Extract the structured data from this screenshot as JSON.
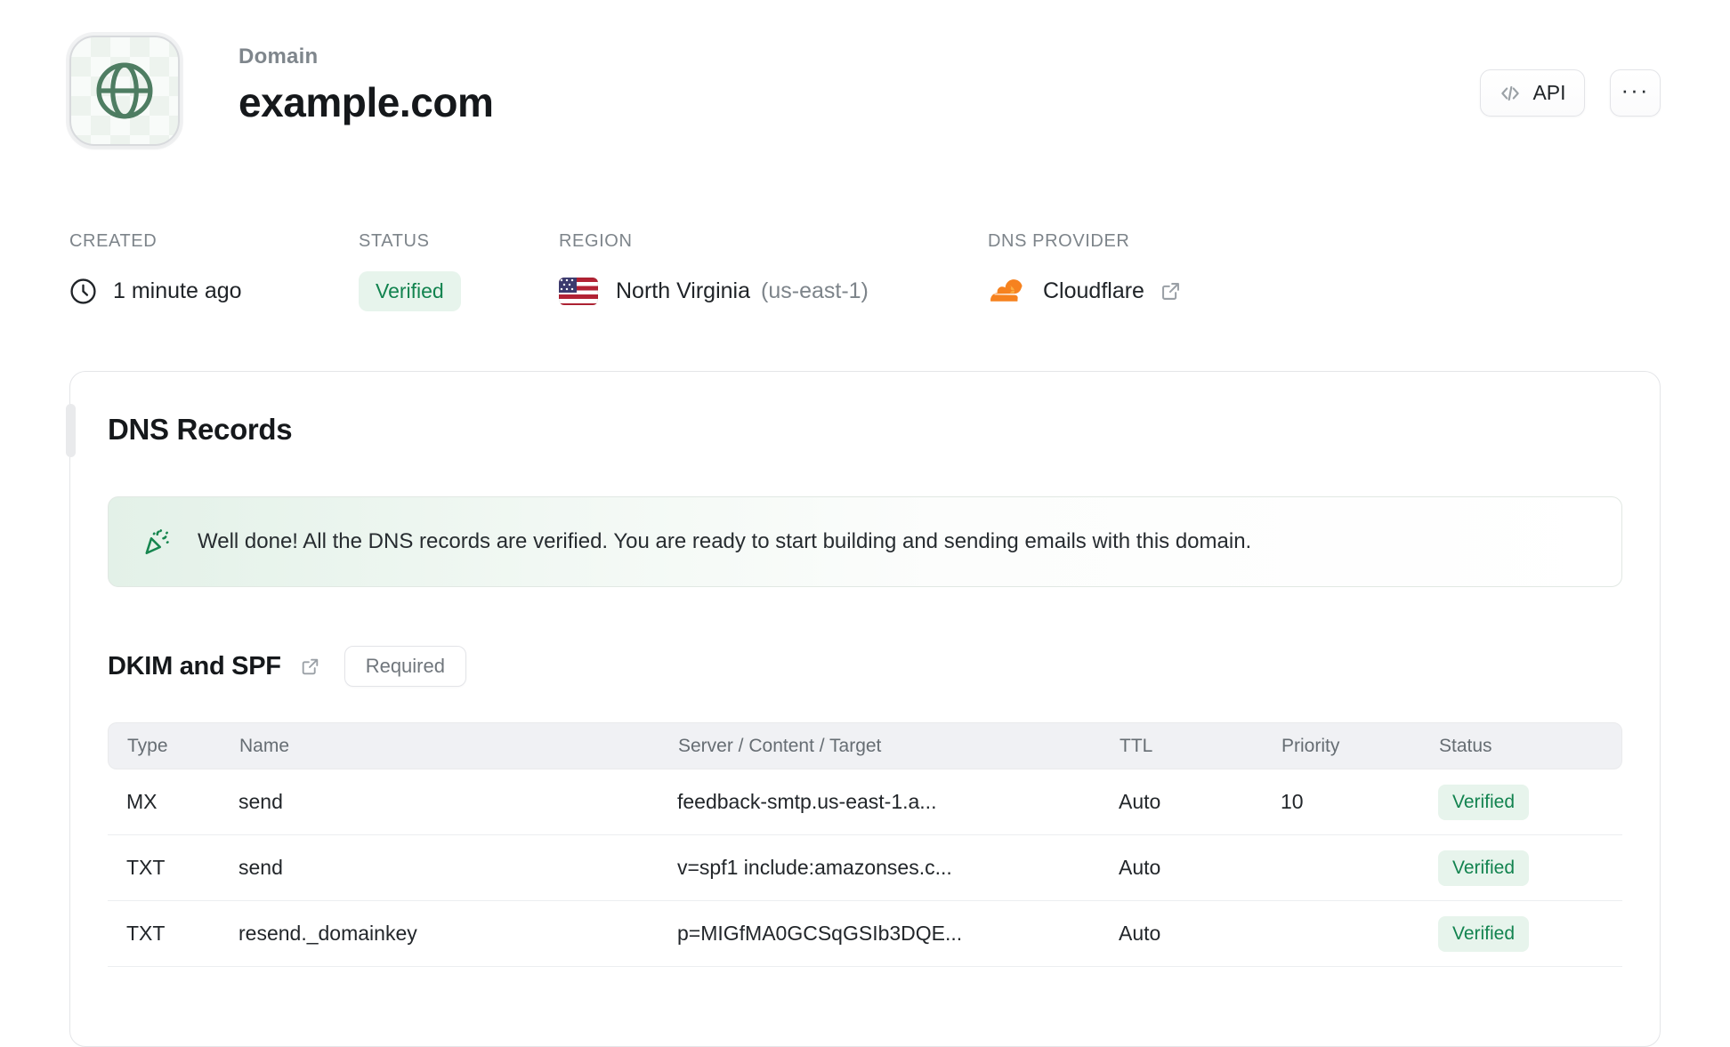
{
  "header": {
    "kicker": "Domain",
    "title": "example.com",
    "api_label": "API",
    "more_label": "···"
  },
  "meta": {
    "created": {
      "label": "CREATED",
      "value": "1 minute ago"
    },
    "status": {
      "label": "STATUS",
      "value": "Verified"
    },
    "region": {
      "label": "REGION",
      "name": "North Virginia",
      "code": "(us-east-1)"
    },
    "dns_provider": {
      "label": "DNS PROVIDER",
      "value": "Cloudflare"
    }
  },
  "dns_card": {
    "title": "DNS Records",
    "success_message": "Well done! All the DNS records are verified. You are ready to start building and sending emails with this domain.",
    "section": {
      "title": "DKIM and SPF",
      "badge": "Required"
    },
    "table": {
      "columns": [
        "Type",
        "Name",
        "Server / Content / Target",
        "TTL",
        "Priority",
        "Status"
      ],
      "rows": [
        {
          "type": "MX",
          "name": "send",
          "content": "feedback-smtp.us-east-1.a...",
          "ttl": "Auto",
          "priority": "10",
          "status": "Verified"
        },
        {
          "type": "TXT",
          "name": "send",
          "content": "v=spf1 include:amazonses.c...",
          "ttl": "Auto",
          "priority": "",
          "status": "Verified"
        },
        {
          "type": "TXT",
          "name": "resend._domainkey",
          "content": "p=MIGfMA0GCSqGSIb3DQE...",
          "ttl": "Auto",
          "priority": "",
          "status": "Verified"
        }
      ]
    }
  },
  "icons": {
    "globe": "globe-icon",
    "code": "code-icon",
    "more": "more-icon",
    "clock": "clock-icon",
    "us_flag": "us-flag-icon",
    "cloudflare": "cloudflare-icon",
    "external_link": "external-link-icon",
    "party_popper": "party-popper-icon"
  },
  "colors": {
    "accent_green": "#12834f",
    "green_badge_bg": "#e7f4ec",
    "globe_green": "#4e7d62",
    "cloudflare_orange": "#f6821f",
    "cloudflare_orange_light": "#fbad41",
    "title_text": "#15181b",
    "muted_text": "#7d848a",
    "border": "#e4e5e8",
    "table_header_bg": "#f0f1f4"
  }
}
